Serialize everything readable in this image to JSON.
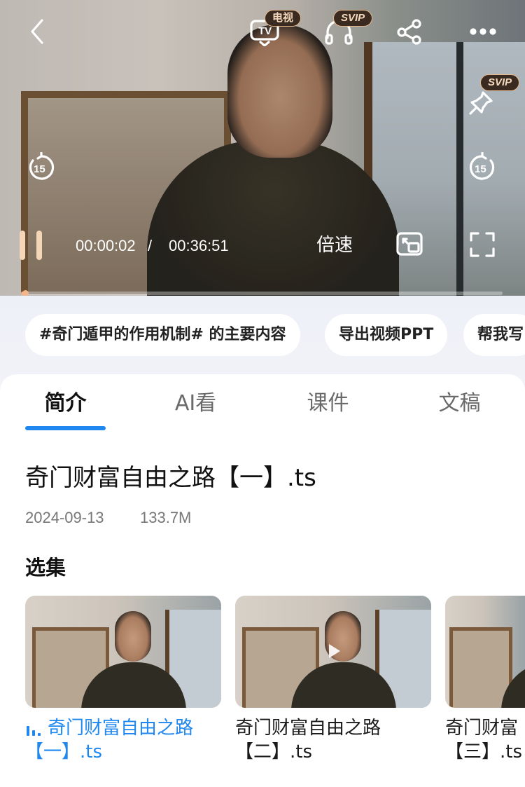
{
  "player": {
    "tv_badge": "电视",
    "svip_badge": "SVIP",
    "pin_badge": "SVIP",
    "rewind_seconds": "15",
    "forward_seconds": "15",
    "current_time": "00:00:02",
    "time_separator": "/",
    "total_time": "00:36:51",
    "speed_label": "倍速",
    "progress": 0.001
  },
  "chips": [
    {
      "label": "#奇门遁甲的作用机制# 的主要内容"
    },
    {
      "label": "导出视频PPT"
    },
    {
      "label": "帮我写"
    }
  ],
  "tabs": [
    {
      "label": "简介",
      "active": true
    },
    {
      "label": "AI看",
      "active": false
    },
    {
      "label": "课件",
      "active": false
    },
    {
      "label": "文稿",
      "active": false
    }
  ],
  "video": {
    "title": "奇门财富自由之路【一】.ts",
    "date": "2024-09-13",
    "size": "133.7M"
  },
  "episodes": {
    "section_title": "选集",
    "items": [
      {
        "line1": "奇门财富自由之路",
        "line2": "【一】.ts",
        "playing": true
      },
      {
        "line1": "奇门财富自由之路",
        "line2": "【二】.ts",
        "playing": false
      },
      {
        "line1": "奇门财富",
        "line2": "【三】.ts",
        "playing": false
      }
    ]
  },
  "colors": {
    "accent": "#1e88f0",
    "progress": "#f5b48a",
    "badge_border": "#e6b98f"
  }
}
